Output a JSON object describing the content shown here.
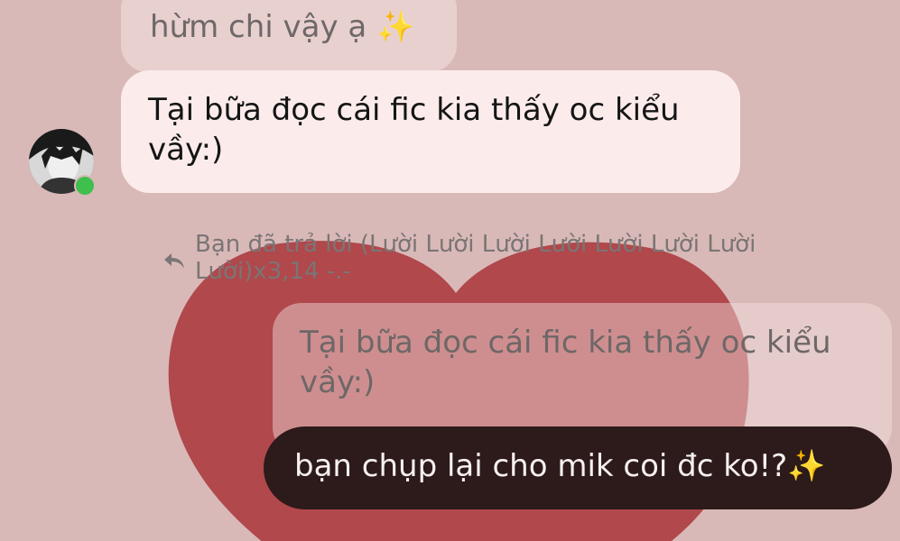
{
  "conversation": {
    "quoted_previous": "hừm chi vậy ạ ✨",
    "incoming_message": "Tại bữa đọc cái fic kia thấy oc kiểu vầy:)",
    "reply_notice": "Bạn đã trả lời (Lười Lười Lười Lười Lười Lười Lười Lười)x3,14 -.-",
    "quoted_in_reply": "Tại bữa đọc cái fic kia thấy oc kiểu vầy:)",
    "outgoing_message": "bạn chụp lại cho mik coi đc ko!?✨"
  },
  "icons": {
    "reply": "reply-arrow-icon",
    "presence": "online-status-dot"
  },
  "colors": {
    "background": "#d9b9b8",
    "heart": "#b0484c",
    "incoming_bubble": "#fbeceb",
    "outgoing_bubble": "#2d1a1b",
    "online": "#3fbf4e"
  }
}
